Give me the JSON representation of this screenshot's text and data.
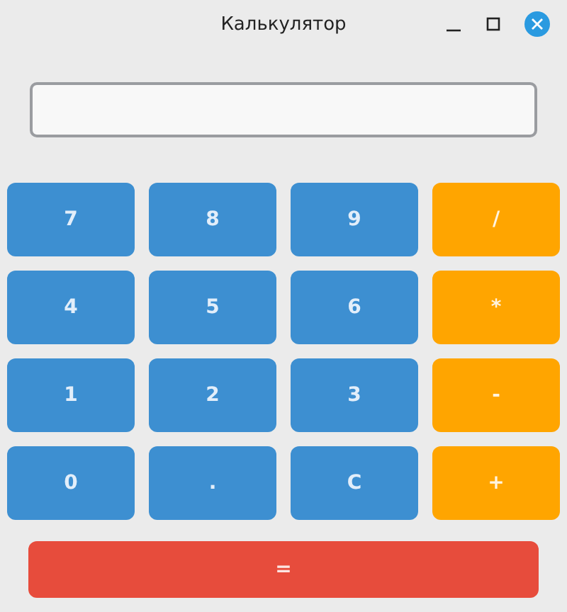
{
  "window": {
    "title": "Калькулятор"
  },
  "keys": [
    {
      "label": "7",
      "kind": "digit"
    },
    {
      "label": "8",
      "kind": "digit"
    },
    {
      "label": "9",
      "kind": "digit"
    },
    {
      "label": "/",
      "kind": "operator"
    },
    {
      "label": "4",
      "kind": "digit"
    },
    {
      "label": "5",
      "kind": "digit"
    },
    {
      "label": "6",
      "kind": "digit"
    },
    {
      "label": "*",
      "kind": "operator"
    },
    {
      "label": "1",
      "kind": "digit"
    },
    {
      "label": "2",
      "kind": "digit"
    },
    {
      "label": "3",
      "kind": "digit"
    },
    {
      "label": "-",
      "kind": "operator"
    },
    {
      "label": "0",
      "kind": "digit"
    },
    {
      "label": ".",
      "kind": "digit"
    },
    {
      "label": "C",
      "kind": "digit"
    },
    {
      "label": "+",
      "kind": "operator"
    }
  ],
  "equals": {
    "label": "="
  }
}
